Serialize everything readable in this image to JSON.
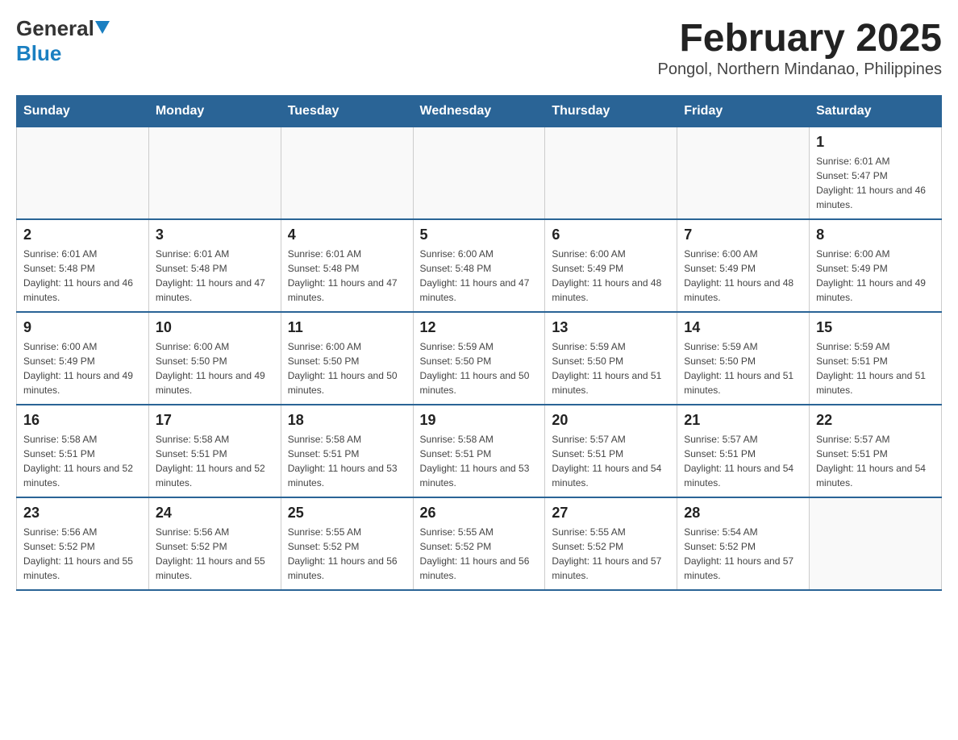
{
  "header": {
    "logo_general": "General",
    "logo_blue": "Blue",
    "title": "February 2025",
    "subtitle": "Pongol, Northern Mindanao, Philippines"
  },
  "calendar": {
    "days_of_week": [
      "Sunday",
      "Monday",
      "Tuesday",
      "Wednesday",
      "Thursday",
      "Friday",
      "Saturday"
    ],
    "weeks": [
      [
        {
          "day": "",
          "info": ""
        },
        {
          "day": "",
          "info": ""
        },
        {
          "day": "",
          "info": ""
        },
        {
          "day": "",
          "info": ""
        },
        {
          "day": "",
          "info": ""
        },
        {
          "day": "",
          "info": ""
        },
        {
          "day": "1",
          "info": "Sunrise: 6:01 AM\nSunset: 5:47 PM\nDaylight: 11 hours and 46 minutes."
        }
      ],
      [
        {
          "day": "2",
          "info": "Sunrise: 6:01 AM\nSunset: 5:48 PM\nDaylight: 11 hours and 46 minutes."
        },
        {
          "day": "3",
          "info": "Sunrise: 6:01 AM\nSunset: 5:48 PM\nDaylight: 11 hours and 47 minutes."
        },
        {
          "day": "4",
          "info": "Sunrise: 6:01 AM\nSunset: 5:48 PM\nDaylight: 11 hours and 47 minutes."
        },
        {
          "day": "5",
          "info": "Sunrise: 6:00 AM\nSunset: 5:48 PM\nDaylight: 11 hours and 47 minutes."
        },
        {
          "day": "6",
          "info": "Sunrise: 6:00 AM\nSunset: 5:49 PM\nDaylight: 11 hours and 48 minutes."
        },
        {
          "day": "7",
          "info": "Sunrise: 6:00 AM\nSunset: 5:49 PM\nDaylight: 11 hours and 48 minutes."
        },
        {
          "day": "8",
          "info": "Sunrise: 6:00 AM\nSunset: 5:49 PM\nDaylight: 11 hours and 49 minutes."
        }
      ],
      [
        {
          "day": "9",
          "info": "Sunrise: 6:00 AM\nSunset: 5:49 PM\nDaylight: 11 hours and 49 minutes."
        },
        {
          "day": "10",
          "info": "Sunrise: 6:00 AM\nSunset: 5:50 PM\nDaylight: 11 hours and 49 minutes."
        },
        {
          "day": "11",
          "info": "Sunrise: 6:00 AM\nSunset: 5:50 PM\nDaylight: 11 hours and 50 minutes."
        },
        {
          "day": "12",
          "info": "Sunrise: 5:59 AM\nSunset: 5:50 PM\nDaylight: 11 hours and 50 minutes."
        },
        {
          "day": "13",
          "info": "Sunrise: 5:59 AM\nSunset: 5:50 PM\nDaylight: 11 hours and 51 minutes."
        },
        {
          "day": "14",
          "info": "Sunrise: 5:59 AM\nSunset: 5:50 PM\nDaylight: 11 hours and 51 minutes."
        },
        {
          "day": "15",
          "info": "Sunrise: 5:59 AM\nSunset: 5:51 PM\nDaylight: 11 hours and 51 minutes."
        }
      ],
      [
        {
          "day": "16",
          "info": "Sunrise: 5:58 AM\nSunset: 5:51 PM\nDaylight: 11 hours and 52 minutes."
        },
        {
          "day": "17",
          "info": "Sunrise: 5:58 AM\nSunset: 5:51 PM\nDaylight: 11 hours and 52 minutes."
        },
        {
          "day": "18",
          "info": "Sunrise: 5:58 AM\nSunset: 5:51 PM\nDaylight: 11 hours and 53 minutes."
        },
        {
          "day": "19",
          "info": "Sunrise: 5:58 AM\nSunset: 5:51 PM\nDaylight: 11 hours and 53 minutes."
        },
        {
          "day": "20",
          "info": "Sunrise: 5:57 AM\nSunset: 5:51 PM\nDaylight: 11 hours and 54 minutes."
        },
        {
          "day": "21",
          "info": "Sunrise: 5:57 AM\nSunset: 5:51 PM\nDaylight: 11 hours and 54 minutes."
        },
        {
          "day": "22",
          "info": "Sunrise: 5:57 AM\nSunset: 5:51 PM\nDaylight: 11 hours and 54 minutes."
        }
      ],
      [
        {
          "day": "23",
          "info": "Sunrise: 5:56 AM\nSunset: 5:52 PM\nDaylight: 11 hours and 55 minutes."
        },
        {
          "day": "24",
          "info": "Sunrise: 5:56 AM\nSunset: 5:52 PM\nDaylight: 11 hours and 55 minutes."
        },
        {
          "day": "25",
          "info": "Sunrise: 5:55 AM\nSunset: 5:52 PM\nDaylight: 11 hours and 56 minutes."
        },
        {
          "day": "26",
          "info": "Sunrise: 5:55 AM\nSunset: 5:52 PM\nDaylight: 11 hours and 56 minutes."
        },
        {
          "day": "27",
          "info": "Sunrise: 5:55 AM\nSunset: 5:52 PM\nDaylight: 11 hours and 57 minutes."
        },
        {
          "day": "28",
          "info": "Sunrise: 5:54 AM\nSunset: 5:52 PM\nDaylight: 11 hours and 57 minutes."
        },
        {
          "day": "",
          "info": ""
        }
      ]
    ]
  }
}
